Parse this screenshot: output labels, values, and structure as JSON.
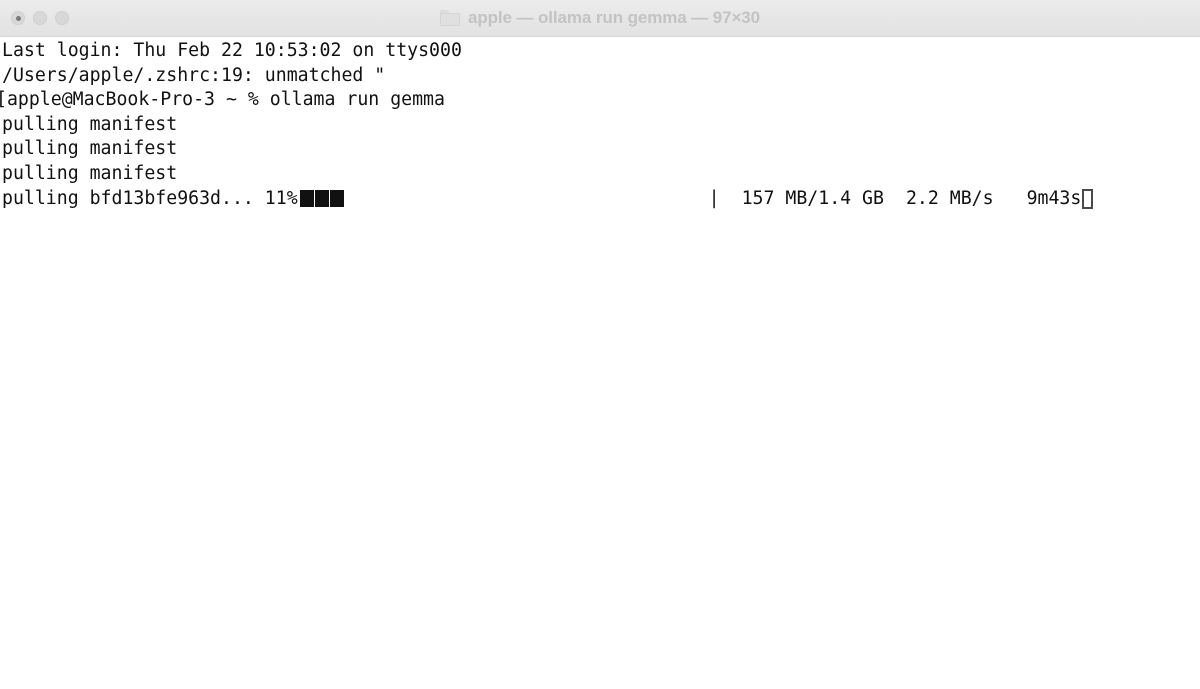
{
  "window": {
    "title": "apple — ollama run gemma — 97×30",
    "folder_icon": "folder-icon",
    "controls": {
      "close_label": "close",
      "minimize_label": "minimize",
      "zoom_label": "zoom"
    }
  },
  "terminal": {
    "background_color": "#ffffff",
    "text_color": "#111111",
    "lines": [
      {
        "id": "login",
        "text": "Last login: Thu Feb 22 10:53:02 on ttys000"
      },
      {
        "id": "zshrc-warning",
        "text": "/Users/apple/.zshrc:19: unmatched \""
      },
      {
        "id": "prompt",
        "text": "[apple@MacBook-Pro-3 ~ % ollama run gemma"
      },
      {
        "id": "manifest-1",
        "text": "pulling manifest"
      },
      {
        "id": "manifest-2",
        "text": "pulling manifest"
      },
      {
        "id": "manifest-3",
        "text": "pulling manifest"
      }
    ],
    "progress": {
      "label": "pulling bfd13bfe963d... ",
      "percent_text": "11%",
      "percent_value": 11,
      "blocks_filled": 3,
      "separator": "|",
      "size_text": "157 MB/1.4 GB",
      "speed_text": "2.2 MB/s",
      "eta_text": "9m43s",
      "bar_color": "#111111"
    },
    "cursor": {
      "style": "hollow-block",
      "color": "#4a4a4a"
    }
  }
}
